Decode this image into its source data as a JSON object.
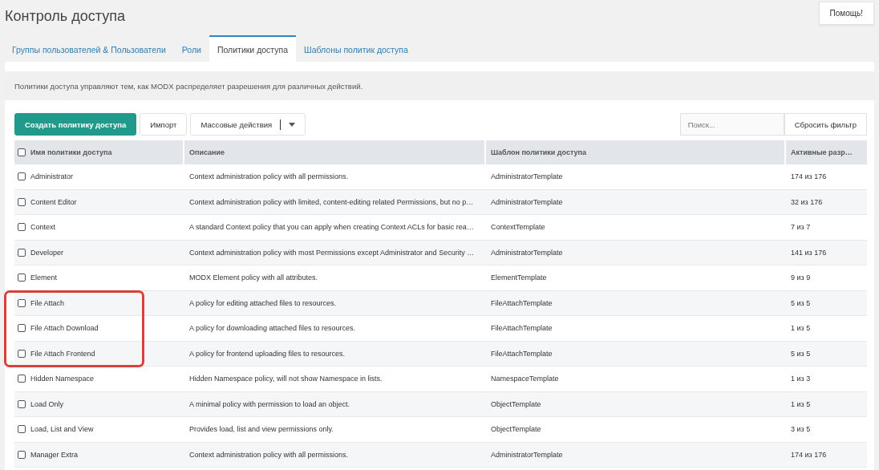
{
  "page_title": "Контроль доступа",
  "help_button": "Помощь!",
  "tabs": [
    {
      "label": "Группы пользователей & Пользователи",
      "selected": false
    },
    {
      "label": "Роли",
      "selected": false
    },
    {
      "label": "Политики доступа",
      "selected": true
    },
    {
      "label": "Шаблоны политик доступа",
      "selected": false
    }
  ],
  "description": "Политики доступа управляют тем, как MODX распределяет разрешения для различных действий.",
  "toolbar": {
    "create_button": "Создать политику доступа",
    "import_button": "Импорт",
    "bulk_actions": "Массовые действия",
    "search": {
      "placeholder": "Поиск..."
    },
    "reset_button": "Сбросить фильтр"
  },
  "table": {
    "all_checked": false,
    "columns": [
      "Имя политики доступа",
      "Описание",
      "Шаблон политики доступа",
      "Активные разр…"
    ],
    "rows": [
      {
        "checked": false,
        "highlighted": false,
        "cells": [
          "Administrator",
          "Context administration policy with all permissions.",
          "AdministratorTemplate",
          "174 из 176"
        ]
      },
      {
        "checked": false,
        "highlighted": false,
        "cells": [
          "Content Editor",
          "Context administration policy with limited, content-editing related Permissions, but no p…",
          "AdministratorTemplate",
          "32 из 176"
        ]
      },
      {
        "checked": false,
        "highlighted": false,
        "cells": [
          "Context",
          "A standard Context policy that you can apply when creating Context ACLs for basic rea…",
          "ContextTemplate",
          "7 из 7"
        ]
      },
      {
        "checked": false,
        "highlighted": false,
        "cells": [
          "Developer",
          "Context administration policy with most Permissions except Administrator and Security …",
          "AdministratorTemplate",
          "141 из 176"
        ]
      },
      {
        "checked": false,
        "highlighted": false,
        "cells": [
          "Element",
          "MODX Element policy with all attributes.",
          "ElementTemplate",
          "9 из 9"
        ]
      },
      {
        "checked": false,
        "highlighted": true,
        "cells": [
          "File Attach",
          "A policy for editing attached files to resources.",
          "FileAttachTemplate",
          "5 из 5"
        ]
      },
      {
        "checked": false,
        "highlighted": true,
        "cells": [
          "File Attach Download",
          "A policy for downloading attached files to resources.",
          "FileAttachTemplate",
          "1 из 5"
        ]
      },
      {
        "checked": false,
        "highlighted": true,
        "cells": [
          "File Attach Frontend",
          "A policy for frontend uploading files to resources.",
          "FileAttachTemplate",
          "5 из 5"
        ]
      },
      {
        "checked": false,
        "highlighted": false,
        "cells": [
          "Hidden Namespace",
          "Hidden Namespace policy, will not show Namespace in lists.",
          "NamespaceTemplate",
          "1 из 3"
        ]
      },
      {
        "checked": false,
        "highlighted": false,
        "cells": [
          "Load Only",
          "A minimal policy with permission to load an object.",
          "ObjectTemplate",
          "1 из 5"
        ]
      },
      {
        "checked": false,
        "highlighted": false,
        "cells": [
          "Load, List and View",
          "Provides load, list and view permissions only.",
          "ObjectTemplate",
          "3 из 5"
        ]
      },
      {
        "checked": false,
        "highlighted": false,
        "cells": [
          "Manager Extra",
          "Context administration policy with all permissions.",
          "AdministratorTemplate",
          "174 из 176"
        ]
      }
    ]
  }
}
